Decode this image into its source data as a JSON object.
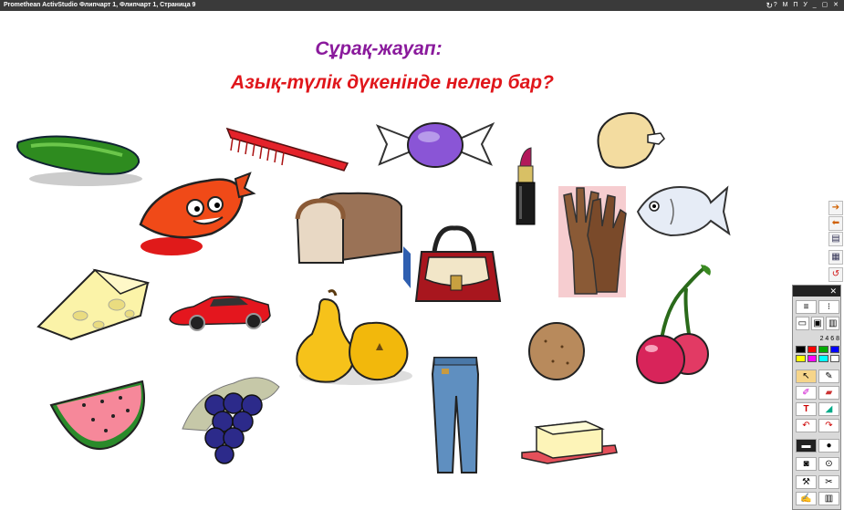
{
  "window": {
    "title": "Promethean ActivStudio   Флипчарт 1,  Флипчарт 1,  Страница 9",
    "controls": "? М П У _ ▢ ✕"
  },
  "page": {
    "heading": "Сұрақ-жауап:",
    "question": "Азық-түлік дүкенінде нелер бар?"
  },
  "icons": {
    "refresh": "↻",
    "next": "➔",
    "prev": "⬅",
    "page": "▤",
    "grid": "▦",
    "cycle": "↺",
    "close": "✕"
  },
  "toolbox": {
    "close_label": "✕",
    "colors": [
      "#000000",
      "#ff0000",
      "#00a000",
      "#0000ff",
      "#ffff00",
      "#ff00ff",
      "#00ffff",
      "#ffffff"
    ],
    "sizes_label": "2 4 6 8"
  }
}
